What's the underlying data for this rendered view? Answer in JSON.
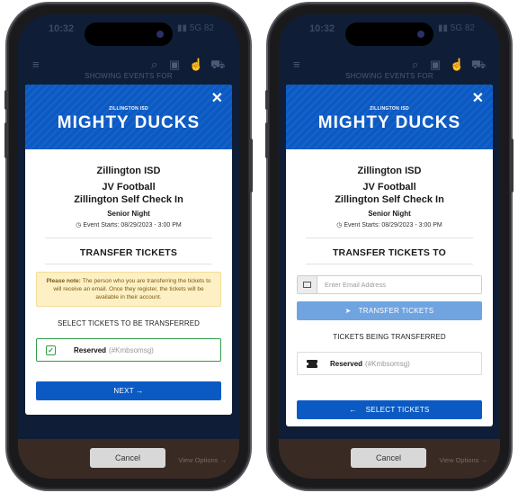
{
  "status_bar": {
    "time": "10:32",
    "icons": "▮▮ 5G 82"
  },
  "background": {
    "showing_text": "SHOWING EVENTS FOR",
    "view_options": "View Options →"
  },
  "banner": {
    "subtitle": "ZILLINGTON ISD",
    "title": "MIGHTY DUCKS",
    "close_icon": "✕"
  },
  "event": {
    "organization": "Zillington ISD",
    "name_line1": "JV Football",
    "name_line2": "Zillington Self Check In",
    "night": "Senior Night",
    "starts": "Event Starts: 08/29/2023 - 3:00 PM"
  },
  "screen1": {
    "section_title": "TRANSFER TICKETS",
    "note_bold": "Please note:",
    "note_text": " The person who you are transferring the tickets to will receive an email. Once they register, the tickets will be available in their account.",
    "select_heading": "SELECT TICKETS TO BE TRANSFERRED",
    "ticket": {
      "label": "Reserved",
      "code": "(#Kmbsomsg)",
      "checked": true
    },
    "next_button": "NEXT →",
    "cancel_button": "Cancel"
  },
  "screen2": {
    "section_title": "TRANSFER TICKETS TO",
    "email_placeholder": "Enter Email Address",
    "transfer_button": "TRANSFER TICKETS",
    "being_transferred_heading": "TICKETS BEING TRANSFERRED",
    "ticket": {
      "label": "Reserved",
      "code": "(#Kmbsomsg)"
    },
    "select_tickets_button": "SELECT TICKETS",
    "cancel_button": "Cancel"
  },
  "colors": {
    "brand_blue": "#0b5ac4",
    "light_blue": "#6fa4e0",
    "success_green": "#2e9d46",
    "note_bg": "#fdf0c4"
  },
  "icons": [
    "close-icon",
    "clock-icon",
    "checkbox-checked-icon",
    "arrow-right-icon",
    "envelope-icon",
    "paper-plane-icon",
    "ticket-icon",
    "arrow-left-icon",
    "menu-icon",
    "search-icon",
    "cart-icon"
  ]
}
